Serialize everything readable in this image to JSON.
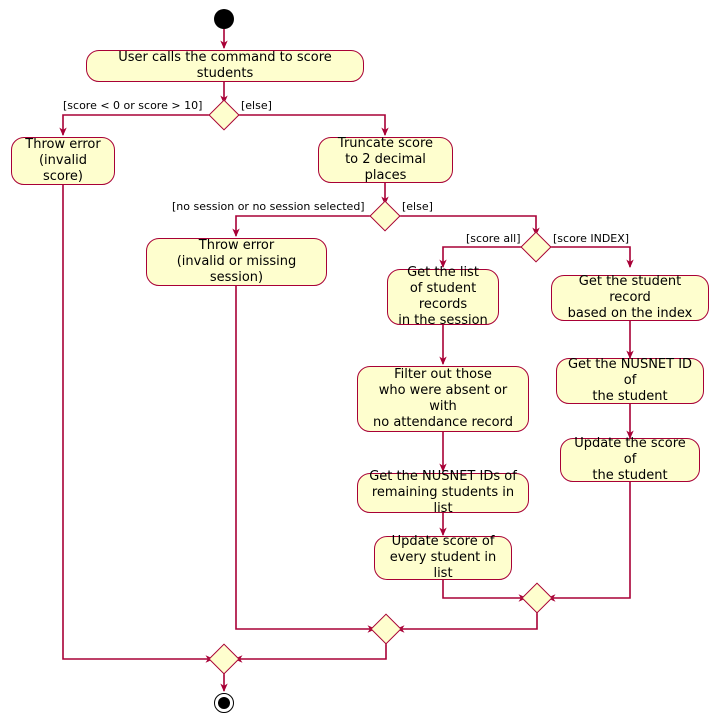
{
  "diagram": {
    "title": "Score students activity diagram",
    "type": "uml-activity-diagram",
    "colors": {
      "node_fill": "#fefece",
      "node_border": "#a80036",
      "edge": "#a80036",
      "terminal": "#000000",
      "background": "#ffffff"
    },
    "start_node": {
      "name": "start"
    },
    "end_node": {
      "name": "end"
    },
    "activities": [
      {
        "id": "a1",
        "label": "User calls the command to score students"
      },
      {
        "id": "a2",
        "label": "Throw error\n(invalid score)"
      },
      {
        "id": "a3",
        "label": "Truncate score\nto 2 decimal places"
      },
      {
        "id": "a4",
        "label": "Throw error\n(invalid or missing session)"
      },
      {
        "id": "a5",
        "label": "Get the list\nof student records\nin the session"
      },
      {
        "id": "a6",
        "label": "Get the student record\nbased on the index"
      },
      {
        "id": "a7",
        "label": "Filter out those\nwho were absent or with\nno attendance record"
      },
      {
        "id": "a8",
        "label": "Get the NUSNET ID of\nthe student"
      },
      {
        "id": "a9",
        "label": "Get the NUSNET IDs of\nremaining students in list"
      },
      {
        "id": "a10",
        "label": "Update the score of\nthe student"
      },
      {
        "id": "a11",
        "label": "Update score of\nevery student in list"
      }
    ],
    "decisions": [
      {
        "id": "d1",
        "name": "score-range-decision"
      },
      {
        "id": "d2",
        "name": "session-decision"
      },
      {
        "id": "d3",
        "name": "score-target-decision"
      }
    ],
    "merges": [
      {
        "id": "m1",
        "name": "merge-score-branches"
      },
      {
        "id": "m2",
        "name": "merge-session-branch"
      },
      {
        "id": "m3",
        "name": "merge-final"
      }
    ],
    "guards": [
      {
        "id": "g1",
        "label": "[score < 0 or score > 10]"
      },
      {
        "id": "g2",
        "label": "[else]"
      },
      {
        "id": "g3",
        "label": "[no session or no session selected]"
      },
      {
        "id": "g4",
        "label": "[else]"
      },
      {
        "id": "g5",
        "label": "[score all]"
      },
      {
        "id": "g6",
        "label": "[score INDEX]"
      }
    ]
  }
}
